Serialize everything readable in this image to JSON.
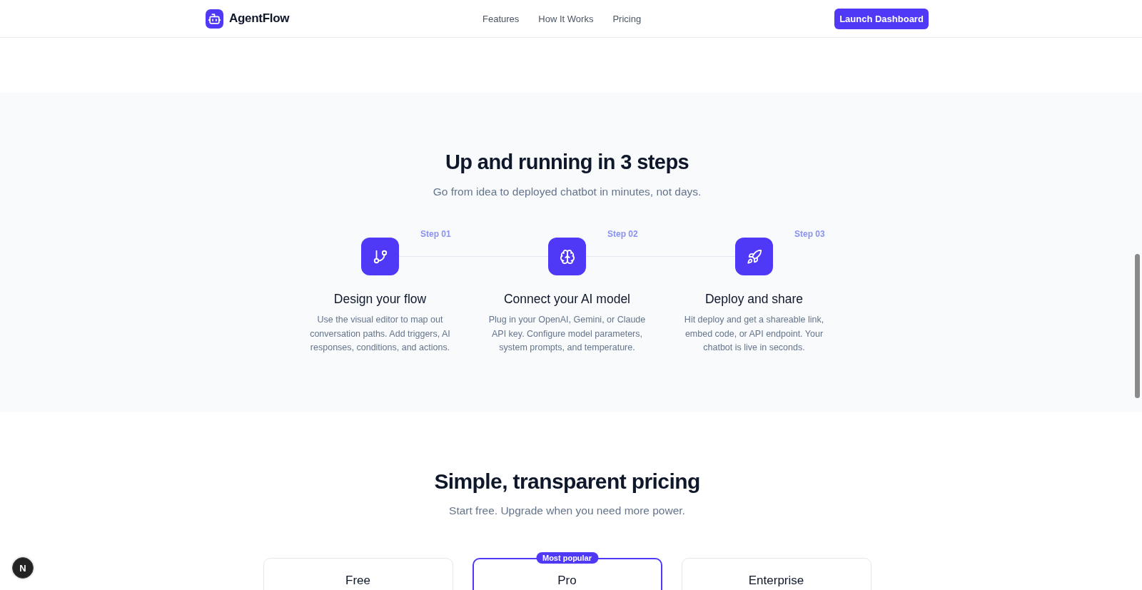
{
  "header": {
    "brand": "AgentFlow",
    "nav_links": [
      "Features",
      "How It Works",
      "Pricing"
    ],
    "cta": "Launch Dashboard"
  },
  "steps_section": {
    "title": "Up and running in 3 steps",
    "subtitle": "Go from idea to deployed chatbot in minutes, not days.",
    "steps": [
      {
        "label": "Step 01",
        "title": "Design your flow",
        "description": "Use the visual editor to map out conversation paths. Add triggers, AI responses, conditions, and actions."
      },
      {
        "label": "Step 02",
        "title": "Connect your AI model",
        "description": "Plug in your OpenAI, Gemini, or Claude API key. Configure model parameters, system prompts, and temperature."
      },
      {
        "label": "Step 03",
        "title": "Deploy and share",
        "description": "Hit deploy and get a shareable link, embed code, or API endpoint. Your chatbot is live in seconds."
      }
    ]
  },
  "pricing_section": {
    "title": "Simple, transparent pricing",
    "subtitle": "Start free. Upgrade when you need more power.",
    "plans": [
      {
        "name": "Free",
        "featured": false
      },
      {
        "name": "Pro",
        "featured": true,
        "badge": "Most popular"
      },
      {
        "name": "Enterprise",
        "featured": false
      }
    ]
  },
  "floating_button": {
    "label": "N"
  }
}
